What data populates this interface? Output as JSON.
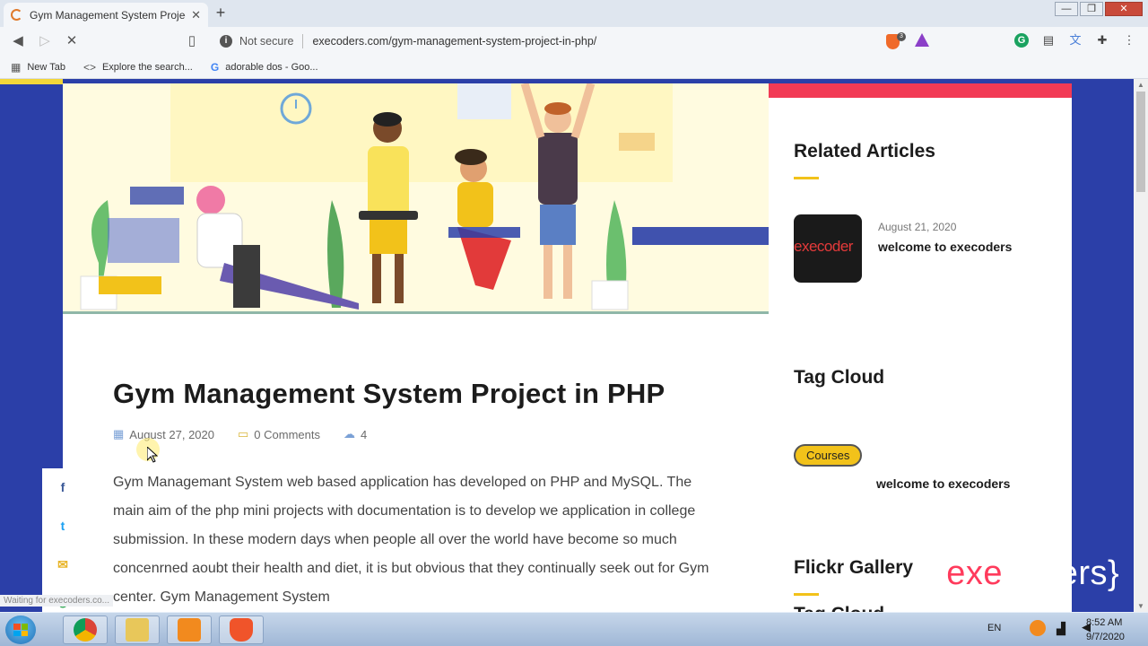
{
  "browser": {
    "tab_title": "Gym Management System Project",
    "tab_close": "✕",
    "new_tab": "+",
    "not_secure": "Not secure",
    "url": "execoders.com/gym-management-system-project-in-php/",
    "shield_count": "3",
    "bookmarks": [
      {
        "label": "New Tab",
        "icon": "grid-icon"
      },
      {
        "label": "Explore the search...",
        "icon": "code-icon"
      },
      {
        "label": "adorable dos - Goo...",
        "icon": "google-icon"
      }
    ]
  },
  "post": {
    "title": "Gym Management System Project in PHP",
    "date": "August 27, 2020",
    "comments": "0 Comments",
    "views": "4",
    "body": "Gym Managemant System web based application has developed on PHP and MySQL. The main aim of the php mini projects with documentation is to develop we application in college submission. In these modern days when people all over the world have become so much concenrned aoubt their health and diet, it is but obvious that they continually seek out for Gym center. Gym Management System"
  },
  "sidebar": {
    "related_heading": "Related Articles",
    "related": {
      "thumb_text": "execoder",
      "date": "August 21, 2020",
      "title": "welcome to execoders"
    },
    "tag_heading": "Tag Cloud",
    "tag": "Courses",
    "item": "welcome to execoders",
    "flickr_heading": "Flickr Gallery",
    "cloud_heading": "Tag Cloud"
  },
  "logo": {
    "left": "{",
    "red": "exe",
    "white": "coders",
    "right": "}"
  },
  "status_text": "Waiting for execoders.co...",
  "taskbar": {
    "lang": "EN",
    "time": "8:52 AM",
    "date": "9/7/2020"
  },
  "colors": {
    "page_bg": "#2b3fa8",
    "accent_red": "#f23a55",
    "accent_yellow": "#f2c21a"
  }
}
